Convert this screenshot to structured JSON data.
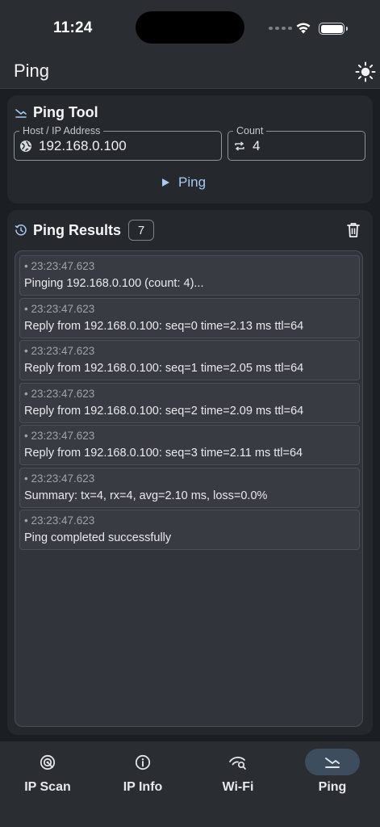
{
  "status_bar": {
    "time": "11:24"
  },
  "app_bar": {
    "title": "Ping",
    "theme_icon": "sun-icon"
  },
  "ping_tool": {
    "title": "Ping Tool",
    "host_label": "Host / IP Address",
    "host_value": "192.168.0.100",
    "count_label": "Count",
    "count_value": "4",
    "ping_button": "Ping"
  },
  "results": {
    "title": "Ping Results",
    "count_badge": "7",
    "entries": [
      {
        "time": "• 23:23:47.623",
        "message": "Pinging 192.168.0.100 (count: 4)..."
      },
      {
        "time": "• 23:23:47.623",
        "message": "Reply from 192.168.0.100: seq=0 time=2.13 ms ttl=64"
      },
      {
        "time": "• 23:23:47.623",
        "message": "Reply from 192.168.0.100: seq=1 time=2.05 ms ttl=64"
      },
      {
        "time": "• 23:23:47.623",
        "message": "Reply from 192.168.0.100: seq=2 time=2.09 ms ttl=64"
      },
      {
        "time": "• 23:23:47.623",
        "message": "Reply from 192.168.0.100: seq=3 time=2.11 ms ttl=64"
      },
      {
        "time": "• 23:23:47.623",
        "message": "Summary: tx=4, rx=4, avg=2.10 ms, loss=0.0%"
      },
      {
        "time": "• 23:23:47.623",
        "message": "Ping completed successfully"
      }
    ]
  },
  "nav": {
    "items": [
      {
        "label": "IP Scan",
        "icon": "radar-icon"
      },
      {
        "label": "IP Info",
        "icon": "info-icon"
      },
      {
        "label": "Wi-Fi",
        "icon": "wifi-search-icon"
      },
      {
        "label": "Ping",
        "icon": "ping-icon",
        "active": true
      }
    ]
  },
  "colors": {
    "accent": "#a9c8f2",
    "surface": "#25282d",
    "background": "#1b1e22",
    "active_pill": "#3e4d5e"
  }
}
